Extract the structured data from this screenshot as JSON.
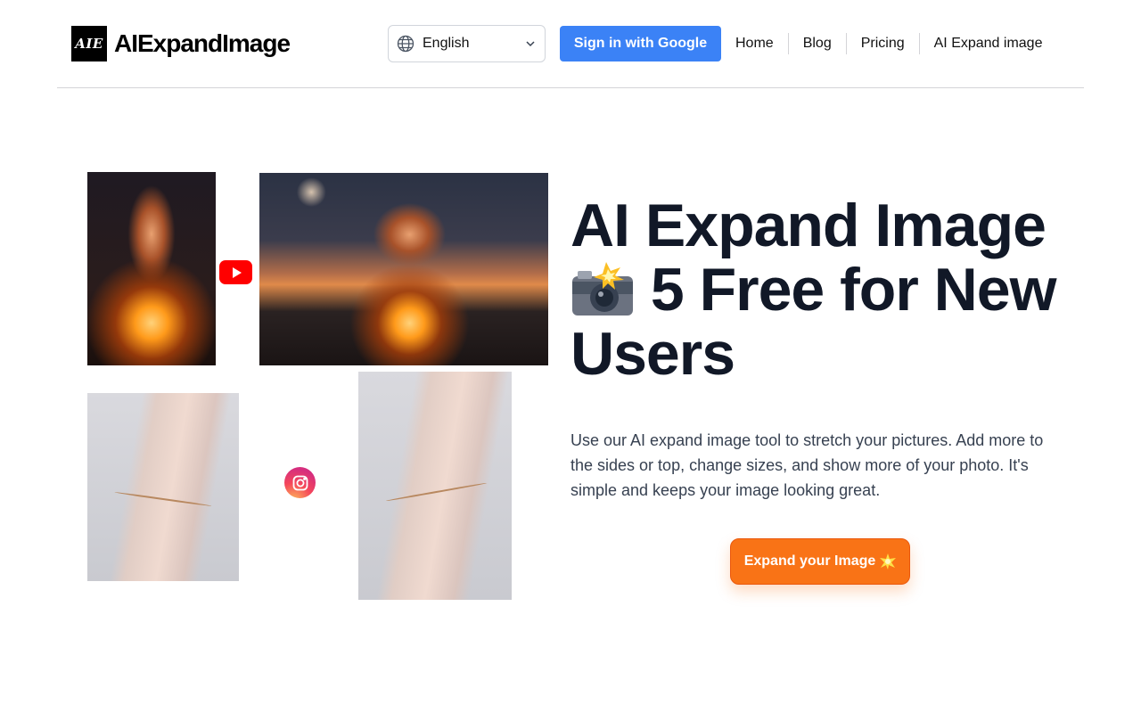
{
  "header": {
    "logo_text": "AIE",
    "brand_name": "AIExpandImage",
    "language": {
      "selected": "English"
    },
    "signin_label": "Sign in with Google",
    "nav": [
      "Home",
      "Blog",
      "Pricing",
      "AI Expand image"
    ]
  },
  "hero": {
    "title": "AI Expand Image",
    "title_emoji_icon": "camera-with-flash-icon",
    "title_rest": "5 Free for New Users",
    "description": "Use our AI expand image tool to stretch your pictures. Add more to the sides or top, change sizes, and show more of your photo. It's simple and keeps your image looking great.",
    "cta_label": "Expand your Image",
    "cta_icon": "glowing-star-icon"
  },
  "colors": {
    "primary_blue": "#3b82f6",
    "cta_orange": "#f97316",
    "heading": "#111827",
    "youtube_red": "#ff0000"
  }
}
